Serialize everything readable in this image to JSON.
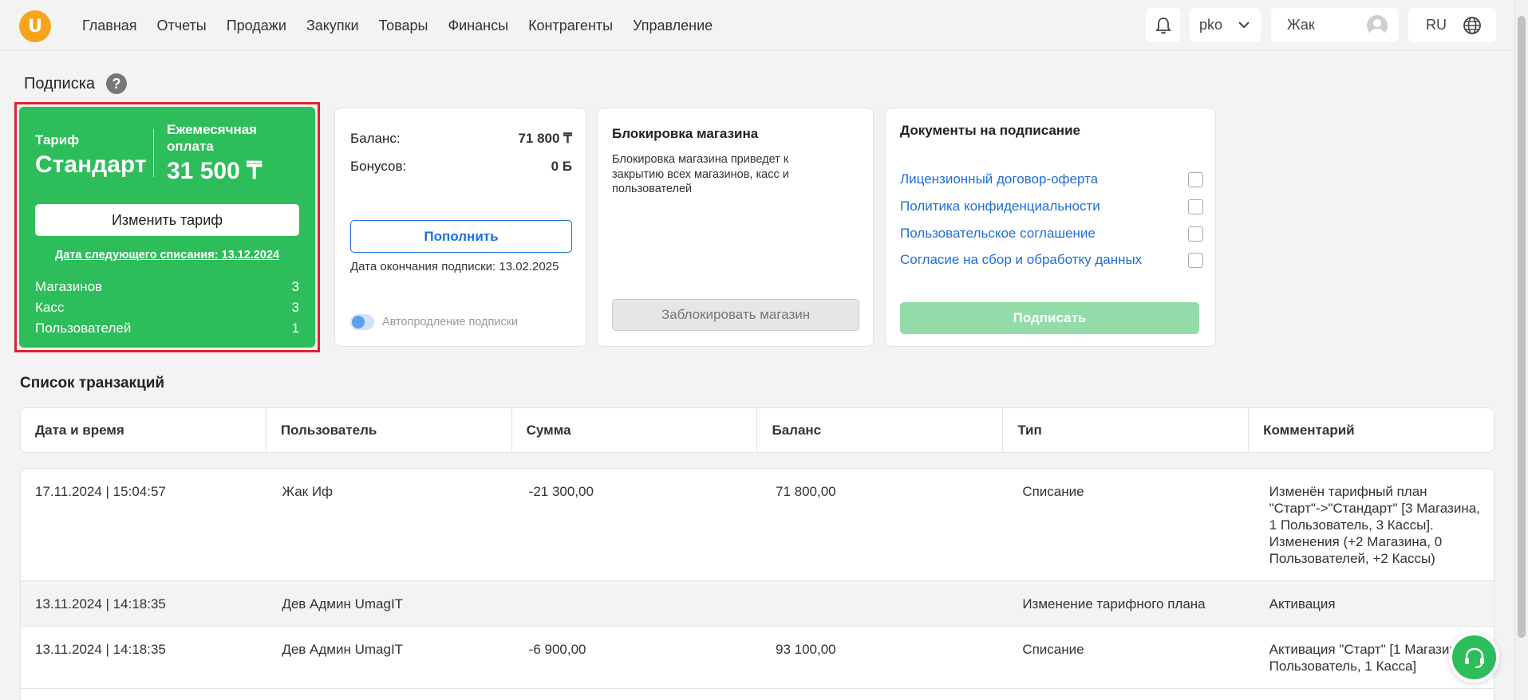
{
  "brand": {
    "logo_letter": "U",
    "accent": "#f6a51b",
    "green": "#2dbd5a",
    "link": "#1e6fd9"
  },
  "nav": [
    "Главная",
    "Отчеты",
    "Продажи",
    "Закупки",
    "Товары",
    "Финансы",
    "Контрагенты",
    "Управление"
  ],
  "header": {
    "org": "pko",
    "user_name": "Жак",
    "language": "RU"
  },
  "page": {
    "title": "Подписка"
  },
  "tariff": {
    "label": "Тариф",
    "name": "Стандарт",
    "monthly_label": "Ежемесячная оплата",
    "monthly_price": "31 500 ₸",
    "change_button": "Изменить тариф",
    "next_charge": "Дата следующего списания: 13.12.2024",
    "stores_label": "Магазинов",
    "stores_value": "3",
    "cashboxes_label": "Касс",
    "cashboxes_value": "3",
    "users_label": "Пользователей",
    "users_value": "1"
  },
  "balance": {
    "balance_label": "Баланс:",
    "balance_value": "71 800 ₸",
    "bonus_label": "Бонусов:",
    "bonus_value": "0 Б",
    "topup_button": "Пополнить",
    "subscription_end": "Дата окончания подписки: 13.02.2025",
    "autorenew_label": "Автопродление подписки"
  },
  "blocking": {
    "title": "Блокировка магазина",
    "text": "Блокировка магазина приведет к закрытию всех магазинов, касс и пользователей",
    "button": "Заблокировать магазин"
  },
  "documents": {
    "title": "Документы на подписание",
    "items": [
      "Лицензионный договор-оферта",
      "Политика конфиденциальности",
      "Пользовательское соглашение",
      "Согласие на сбор и обработку данных"
    ],
    "sign_button": "Подписать"
  },
  "transactions": {
    "title": "Список транзакций",
    "columns": [
      "Дата и время",
      "Пользователь",
      "Сумма",
      "Баланс",
      "Тип",
      "Комментарий"
    ],
    "rows": [
      [
        "17.11.2024 | 15:04:57",
        "Жак Иф",
        "-21 300,00",
        "71 800,00",
        "Списание",
        "Изменён тарифный план\n\"Старт\"->\"Стандарт\" [3 Магазина,\n1 Пользователь, 3 Кассы].\nИзменения (+2 Магазина, 0\nПользователей, +2 Кассы)"
      ],
      [
        "13.11.2024 | 14:18:35",
        "Дев Админ UmagIT",
        "",
        "",
        "Изменение тарифного плана",
        "Активация"
      ],
      [
        "13.11.2024 | 14:18:35",
        "Дев Админ UmagIT",
        "-6 900,00",
        "93 100,00",
        "Списание",
        "Активация \"Старт\" [1 Магазин\nПользователь, 1 Касса]"
      ]
    ]
  }
}
